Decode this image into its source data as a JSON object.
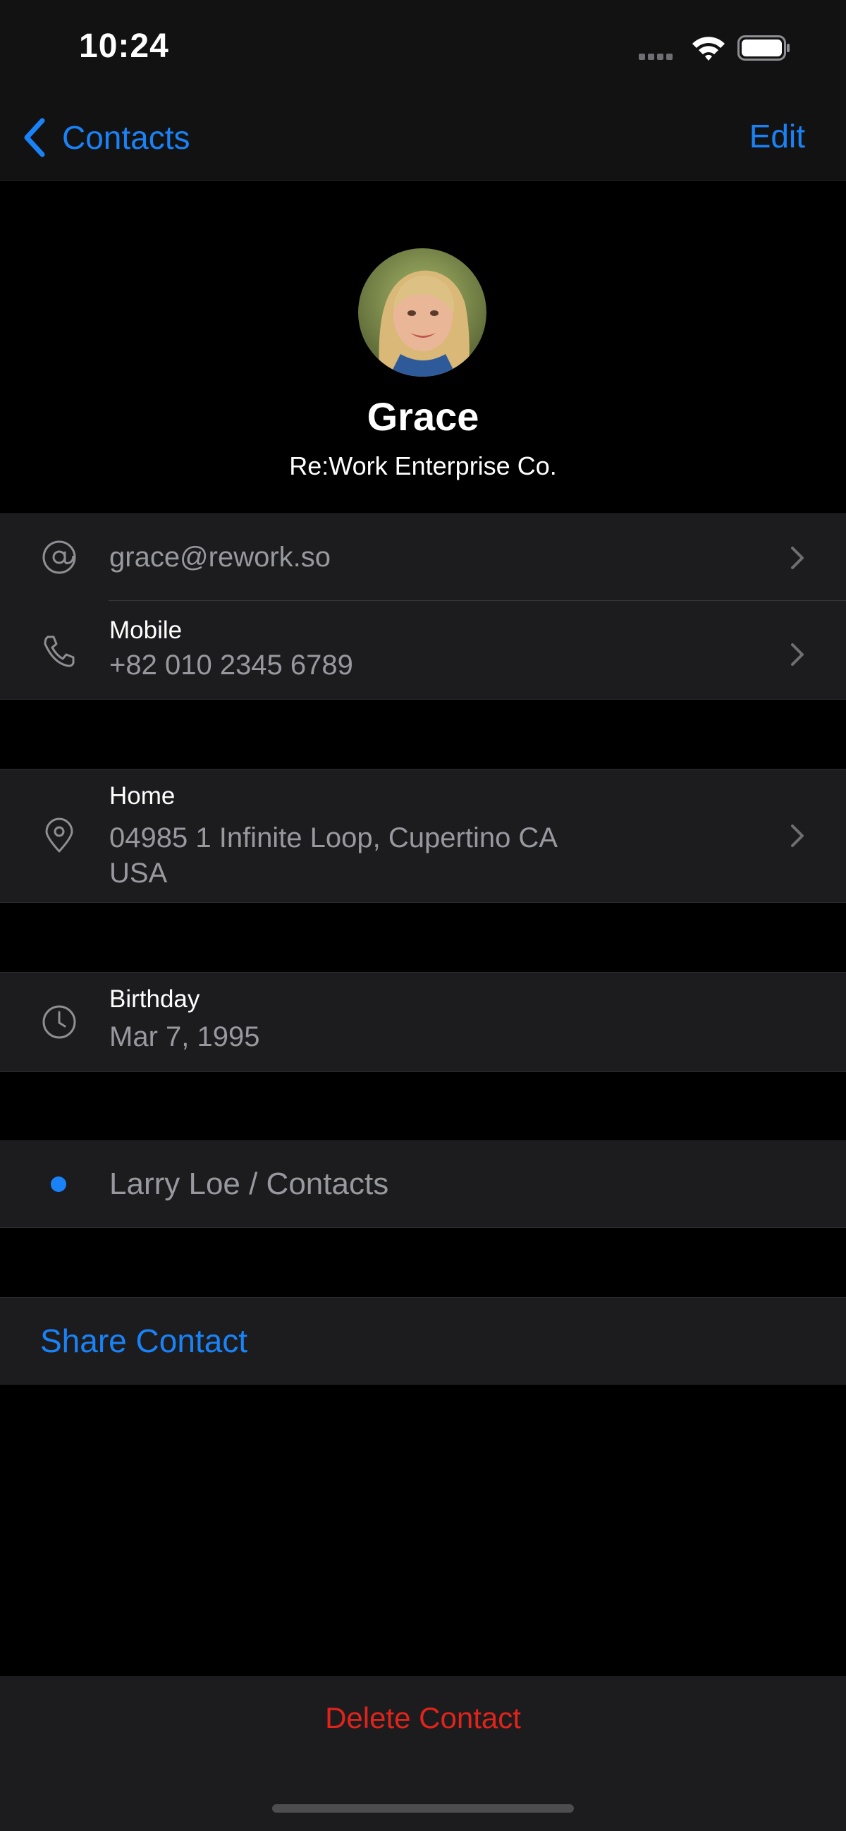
{
  "status_bar": {
    "time": "10:24"
  },
  "nav": {
    "back_label": "Contacts",
    "edit_label": "Edit"
  },
  "contact": {
    "name": "Grace",
    "company": "Re:Work Enterprise Co."
  },
  "email": {
    "value": "grace@rework.so"
  },
  "phone": {
    "label": "Mobile",
    "value": "+82 010 2345 6789"
  },
  "address": {
    "label": "Home",
    "line1": "04985 1 Infinite Loop, Cupertino CA",
    "line2": "USA"
  },
  "birthday": {
    "label": "Birthday",
    "value": "Mar 7, 1995"
  },
  "account": {
    "value": "Larry Loe / Contacts",
    "dot_color": "#1a82f7"
  },
  "actions": {
    "share_label": "Share Contact",
    "delete_label": "Delete Contact"
  },
  "colors": {
    "accent": "#1a82f7",
    "destructive": "#e0241b",
    "cell": "#1c1c1e",
    "secondary_text": "#98989f"
  },
  "icons": [
    "wifi-icon",
    "battery-icon",
    "back-chevron-icon",
    "at-icon",
    "phone-icon",
    "location-pin-icon",
    "clock-icon",
    "disclosure-chevron-icon"
  ]
}
